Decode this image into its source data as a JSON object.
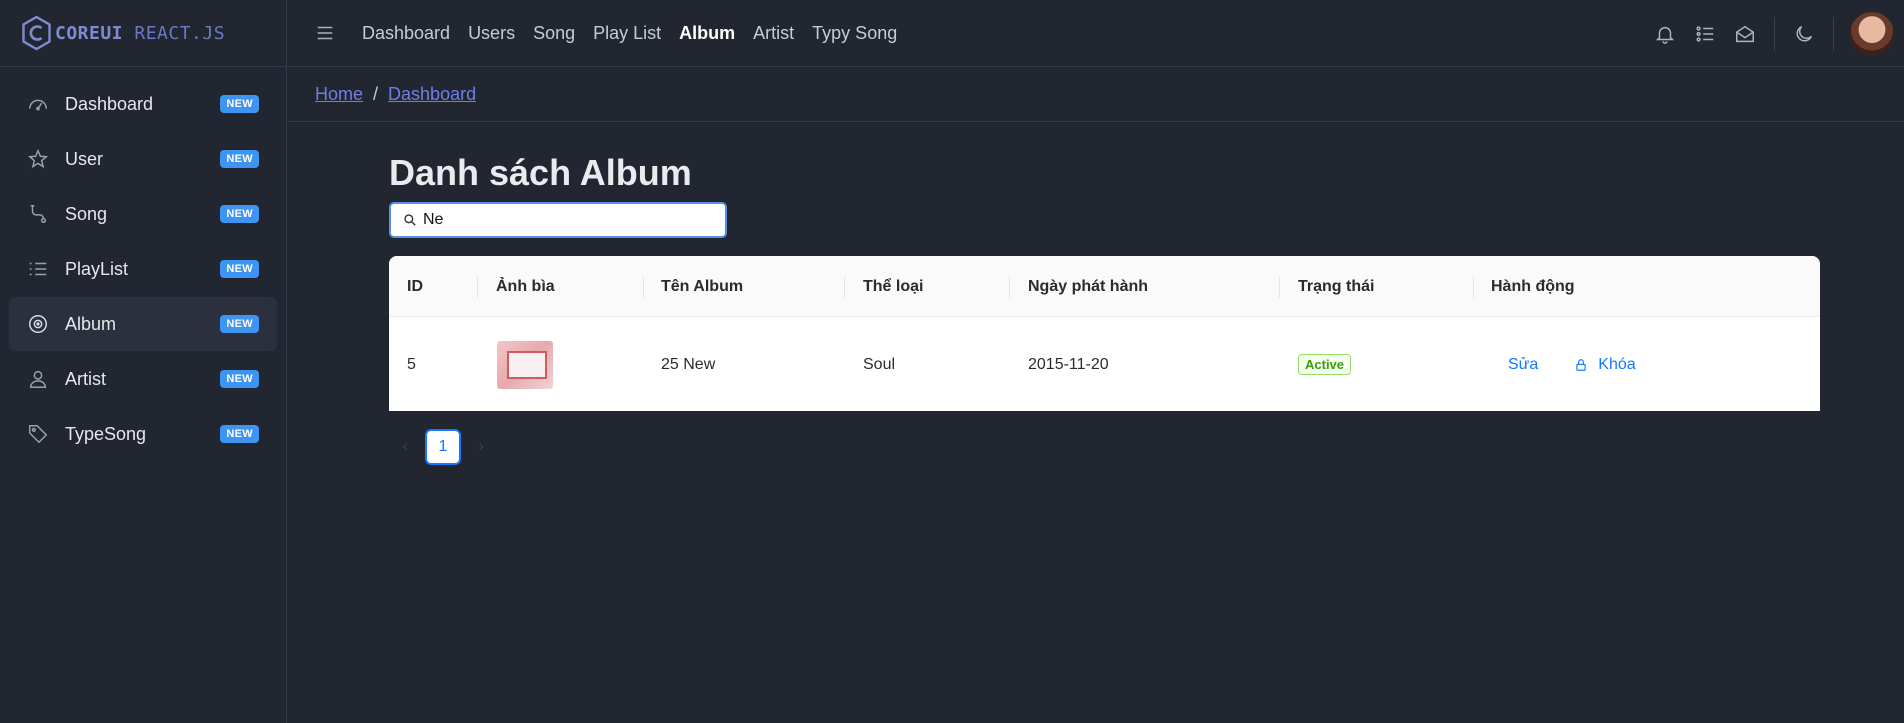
{
  "brand": {
    "core": "COREUI",
    "react": "REACT.JS"
  },
  "sidebar": {
    "items": [
      {
        "label": "Dashboard",
        "badge": "NEW",
        "icon": "speedometer-icon"
      },
      {
        "label": "User",
        "badge": "NEW",
        "icon": "star-icon"
      },
      {
        "label": "Song",
        "badge": "NEW",
        "icon": "route-icon"
      },
      {
        "label": "PlayList",
        "badge": "NEW",
        "icon": "list-icon"
      },
      {
        "label": "Album",
        "badge": "NEW",
        "icon": "disc-icon",
        "active": true
      },
      {
        "label": "Artist",
        "badge": "NEW",
        "icon": "user-icon"
      },
      {
        "label": "TypeSong",
        "badge": "NEW",
        "icon": "tag-icon"
      }
    ]
  },
  "header": {
    "nav": [
      "Dashboard",
      "Users",
      "Song",
      "Play List",
      "Album",
      "Artist",
      "Typy Song"
    ],
    "active_nav": "Album"
  },
  "breadcrumb": {
    "home": "Home",
    "current": "Dashboard"
  },
  "main": {
    "title": "Danh sách Album",
    "search": {
      "value": "Ne"
    }
  },
  "table": {
    "headers": [
      "ID",
      "Ảnh bìa",
      "Tên Album",
      "Thể loại",
      "Ngày phát hành",
      "Trạng thái",
      "Hành động"
    ],
    "rows": [
      {
        "id": "5",
        "name": "25 New",
        "genre": "Soul",
        "release_date": "2015-11-20",
        "status": "Active",
        "edit": "Sửa",
        "lock": "Khóa"
      }
    ]
  },
  "pagination": {
    "current": "1"
  },
  "colors": {
    "accent": "#3d94f2",
    "link": "#1677ff",
    "status_active": "#389e0d"
  }
}
